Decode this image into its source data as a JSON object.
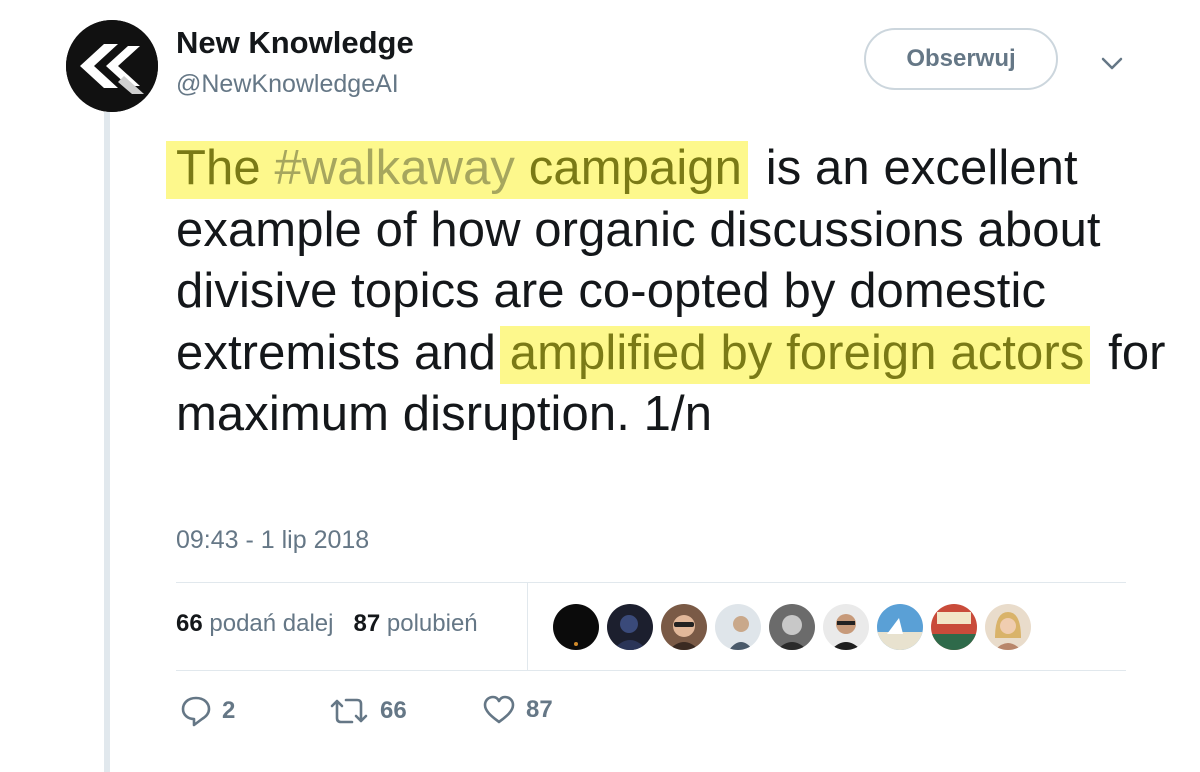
{
  "tweet": {
    "author": {
      "name": "New Knowledge",
      "handle": "@NewKnowledgeAI"
    },
    "follow_label": "Obserwuj",
    "text": {
      "hl1_pre": "The ",
      "hashtag": "#walkaway",
      "hl1_post": " campaign",
      "plain1": " is an excellent example of how organic discussions about divisive topics are co-opted by domestic extremists and ",
      "hl2": "amplified by foreign actors",
      "plain2": " for maximum disruption. 1/n"
    },
    "timestamp": "09:43 - 1 lip 2018",
    "stats": {
      "retweets_count": "66",
      "retweets_label": "podań dalej",
      "likes_count": "87",
      "likes_label": "polubień"
    },
    "actions": {
      "replies": "2",
      "retweets": "66",
      "likes": "87"
    }
  },
  "colors": {
    "highlight": "#fdf88c",
    "highlight_text": "#7a7a16",
    "muted": "#657786",
    "border": "#e1e8ed"
  },
  "icons": [
    "chevron-down-icon",
    "reply-icon",
    "retweet-icon",
    "heart-icon"
  ]
}
